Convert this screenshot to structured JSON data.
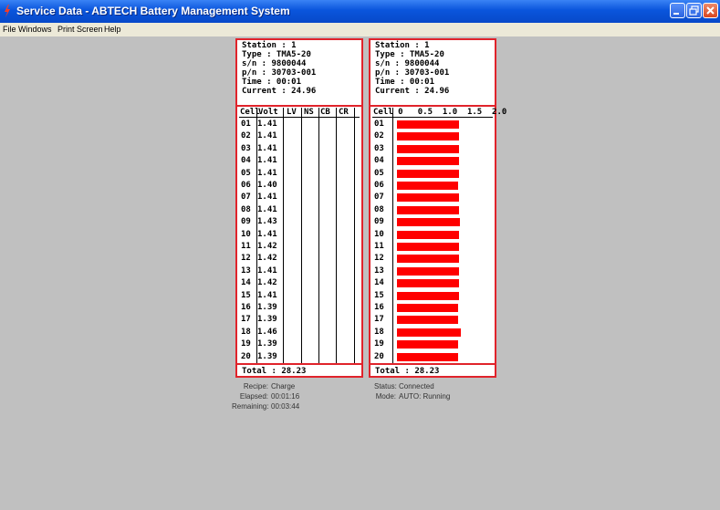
{
  "window": {
    "title": "Service Data - ABTECH Battery Management System",
    "accent_color": "#0a55dc",
    "panel_border_color": "#e0232b",
    "bar_color": "#ff0000"
  },
  "menu": [
    "File",
    "Windows",
    "Print Screen",
    "Help"
  ],
  "left_panel": {
    "info": [
      "Station : 1",
      "Type : TMA5-20",
      "s/n :  9800044",
      "p/n :  30703-001",
      "Time : 00:01",
      "Current : 24.96"
    ],
    "columns": [
      "Cell",
      "Volt",
      "LV",
      "NS",
      "CB",
      "CR"
    ],
    "rows": [
      {
        "cell": "01",
        "volt": "1.41"
      },
      {
        "cell": "02",
        "volt": "1.41"
      },
      {
        "cell": "03",
        "volt": "1.41"
      },
      {
        "cell": "04",
        "volt": "1.41"
      },
      {
        "cell": "05",
        "volt": "1.41"
      },
      {
        "cell": "06",
        "volt": "1.40"
      },
      {
        "cell": "07",
        "volt": "1.41"
      },
      {
        "cell": "08",
        "volt": "1.41"
      },
      {
        "cell": "09",
        "volt": "1.43"
      },
      {
        "cell": "10",
        "volt": "1.41"
      },
      {
        "cell": "11",
        "volt": "1.42"
      },
      {
        "cell": "12",
        "volt": "1.42"
      },
      {
        "cell": "13",
        "volt": "1.41"
      },
      {
        "cell": "14",
        "volt": "1.42"
      },
      {
        "cell": "15",
        "volt": "1.41"
      },
      {
        "cell": "16",
        "volt": "1.39"
      },
      {
        "cell": "17",
        "volt": "1.39"
      },
      {
        "cell": "18",
        "volt": "1.46"
      },
      {
        "cell": "19",
        "volt": "1.39"
      },
      {
        "cell": "20",
        "volt": "1.39"
      }
    ],
    "total": "Total : 28.23"
  },
  "right_panel": {
    "info": [
      "Station : 1",
      "Type : TMA5-20",
      "s/n :  9800044",
      "p/n :  30703-001",
      "Time : 00:01",
      "Current : 24.96"
    ],
    "scale_header": "Cell 0   0.5  1.0  1.5  2.0",
    "scale_max": 2.0,
    "cells": [
      "01",
      "02",
      "03",
      "04",
      "05",
      "06",
      "07",
      "08",
      "09",
      "10",
      "11",
      "12",
      "13",
      "14",
      "15",
      "16",
      "17",
      "18",
      "19",
      "20"
    ],
    "values": [
      1.41,
      1.41,
      1.41,
      1.41,
      1.41,
      1.4,
      1.41,
      1.41,
      1.43,
      1.41,
      1.42,
      1.42,
      1.41,
      1.42,
      1.41,
      1.39,
      1.39,
      1.46,
      1.39,
      1.39
    ],
    "total": "Total : 28.23"
  },
  "status_left": [
    {
      "label": "Recipe:",
      "value": "Charge"
    },
    {
      "label": "Elapsed:",
      "value": "00:01:16"
    },
    {
      "label": "Remaining:",
      "value": "00:03:44"
    }
  ],
  "status_right": [
    {
      "label": "Status:",
      "value": "Connected"
    },
    {
      "label": "Mode:",
      "value": "AUTO: Running"
    }
  ]
}
